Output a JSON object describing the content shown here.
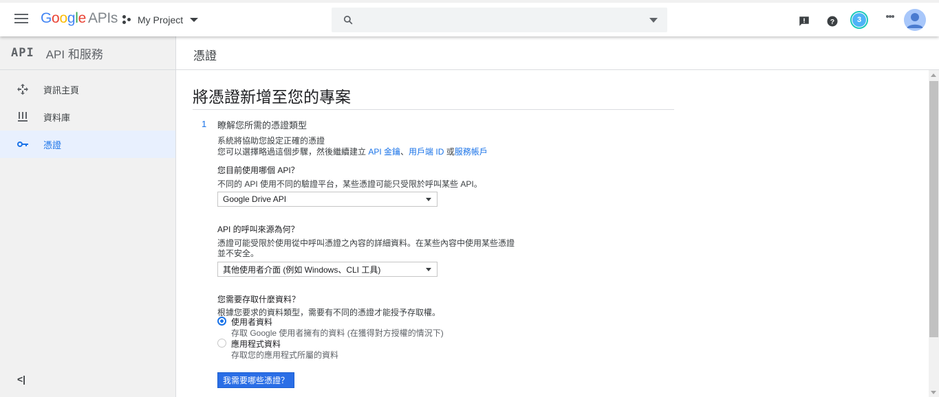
{
  "topbar": {
    "logo_letters": [
      "G",
      "o",
      "o",
      "g",
      "l",
      "e"
    ],
    "logo_suffix": "APIs",
    "project_name": "My Project",
    "search_placeholder": "",
    "notification_count": "3"
  },
  "sidebar": {
    "logo": "API",
    "title": "API 和服務",
    "items": [
      {
        "label": "資訊主頁",
        "icon": "dashboard-icon"
      },
      {
        "label": "資料庫",
        "icon": "library-icon"
      },
      {
        "label": "憑證",
        "icon": "key-icon",
        "active": true
      }
    ],
    "collapse": "<|"
  },
  "main": {
    "header_title": "憑證",
    "page_title": "將憑證新增至您的專案",
    "step": {
      "number": "1",
      "title": "瞭解您所需的憑證類型",
      "desc_line1": "系統將協助您設定正確的憑證",
      "desc_line2_prefix": "您可以選擇略過這個步驟，然後繼續建立 ",
      "link_api_key": "API 金鑰",
      "sep1": "、",
      "link_client_id": "用戶端 ID",
      "sep2": " 或",
      "link_service_account": "服務帳戶"
    },
    "q1": {
      "label": "您目前使用哪個 API？",
      "desc": "不同的 API 使用不同的驗證平台，某些憑證可能只受限於呼叫某些 API。",
      "selected": "Google Drive API"
    },
    "q2": {
      "label": "API 的呼叫來源為何？",
      "desc_line1": "憑證可能受限於使用從中呼叫憑證之內容的詳細資料。在某些內容中使用某些憑證",
      "desc_line2": "並不安全。",
      "selected": "其他使用者介面 (例如 Windows、CLI 工具)"
    },
    "q3": {
      "label": "您需要存取什麼資料？",
      "desc": "根據您要求的資料類型，需要有不同的憑證才能授予存取權。",
      "options": [
        {
          "label": "使用者資料",
          "desc": "存取 Google 使用者擁有的資料 (在獲得對方授權的情況下)",
          "selected": true
        },
        {
          "label": "應用程式資料",
          "desc": "存取您的應用程式所屬的資料",
          "selected": false
        }
      ]
    },
    "submit_label": "我需要哪些憑證？"
  },
  "colors": {
    "accent": "#1a73e8",
    "button": "#2a6ee6",
    "sidebar_bg": "#f1f1f1"
  }
}
